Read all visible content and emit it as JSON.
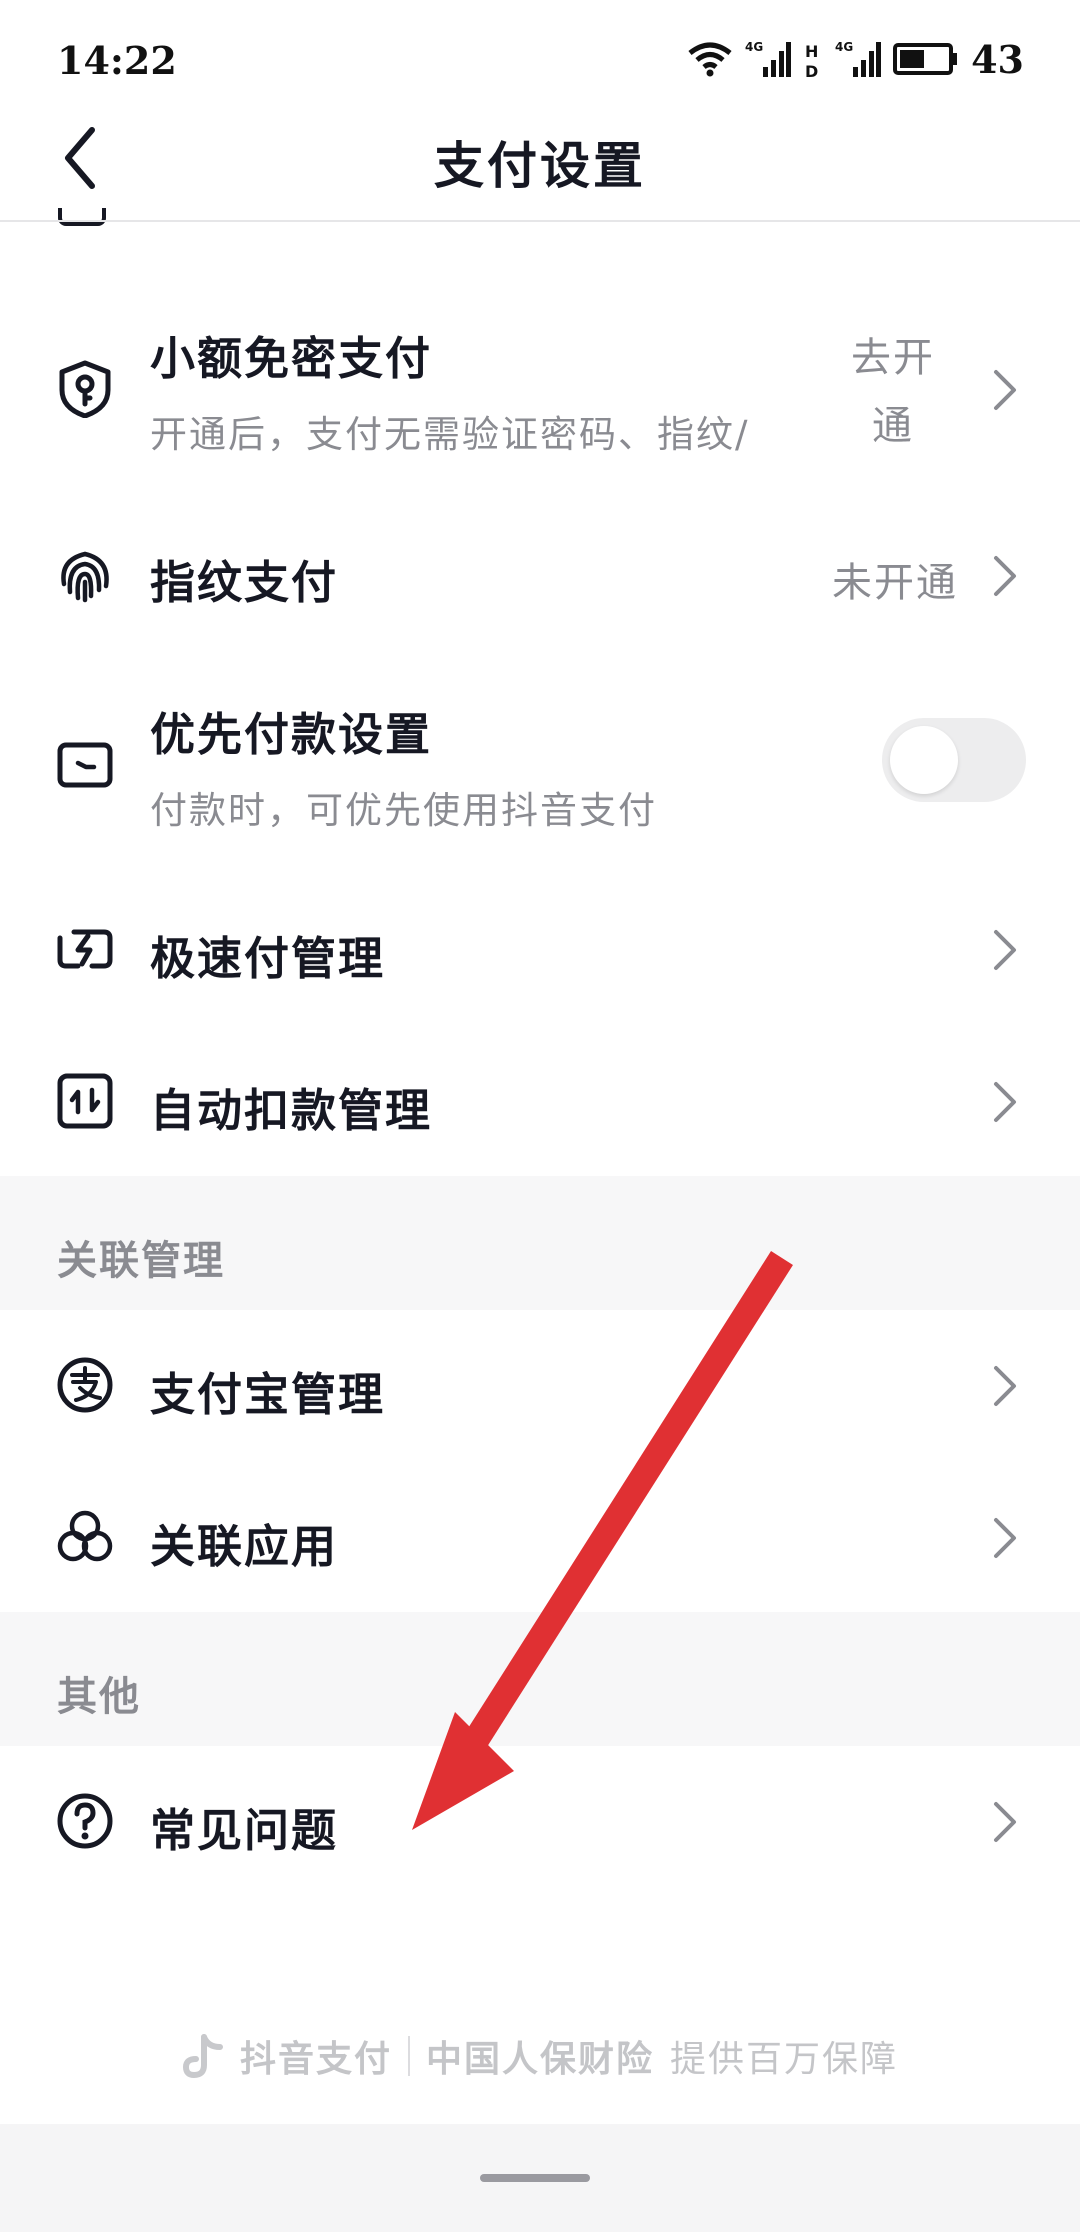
{
  "status_bar": {
    "time": "14:22",
    "network_1": "4G",
    "network_2": "4G",
    "hd": "HD",
    "battery": "43"
  },
  "header": {
    "title": "支付设置"
  },
  "rows": {
    "small_free": {
      "title": "小额免密支付",
      "subtitle": "开通后，支付无需验证密码、指纹/",
      "value": "去开通",
      "icon": "shield-key-icon"
    },
    "fingerprint": {
      "title": "指纹支付",
      "value": "未开通",
      "icon": "fingerprint-icon"
    },
    "priority": {
      "title": "优先付款设置",
      "subtitle": "付款时，可优先使用抖音支付",
      "toggle_on": false,
      "icon": "card-icon"
    },
    "express": {
      "title": "极速付管理",
      "icon": "lightning-icon"
    },
    "auto_debit": {
      "title": "自动扣款管理",
      "icon": "auto-debit-icon"
    },
    "alipay": {
      "title": "支付宝管理",
      "icon": "alipay-icon"
    },
    "linked_apps": {
      "title": "关联应用",
      "icon": "linked-apps-icon"
    },
    "faq": {
      "title": "常见问题",
      "icon": "question-icon"
    }
  },
  "sections": {
    "linked": "关联管理",
    "other": "其他"
  },
  "footer": {
    "brand": "抖音支付",
    "insurer": "中国人保财险",
    "slogan": "提供百万保障"
  },
  "colors": {
    "text_primary": "#161823",
    "text_secondary": "#8a8b91",
    "section_bg": "#f7f7f8",
    "annotation_red": "#e03033"
  }
}
